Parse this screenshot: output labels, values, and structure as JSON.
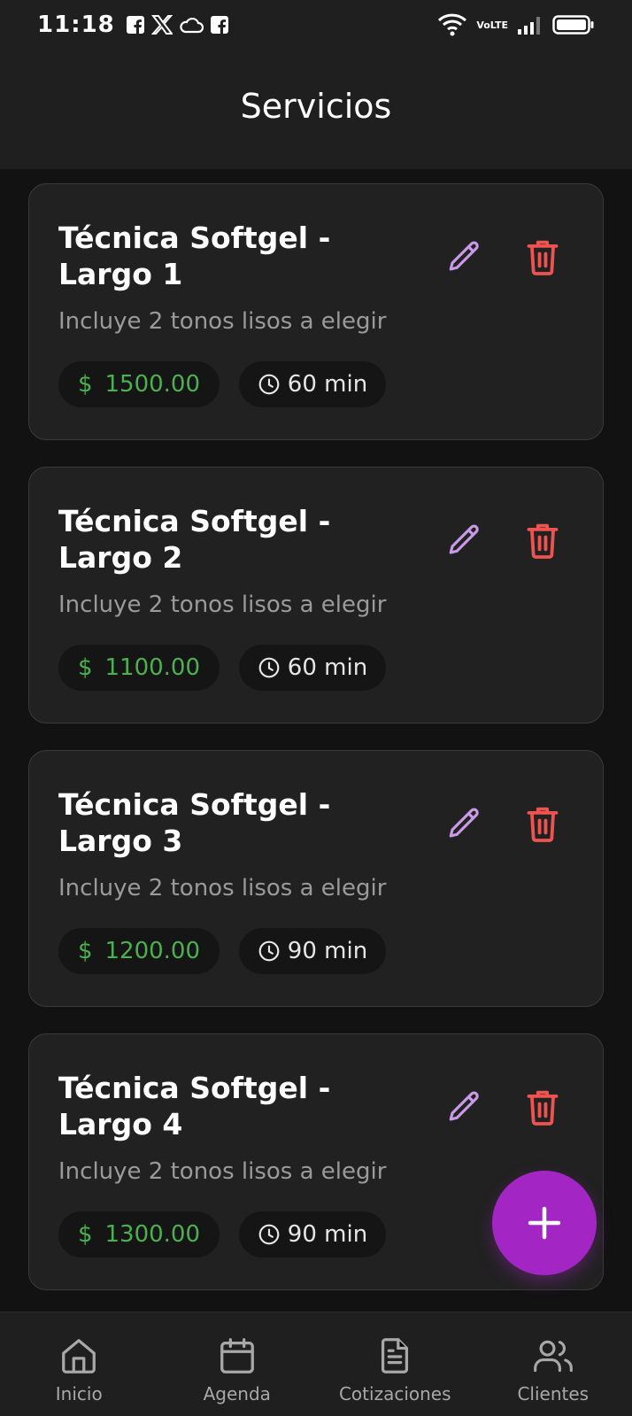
{
  "status_bar": {
    "time": "11:18",
    "left_icons": [
      "facebook-icon",
      "x-icon",
      "cloud-icon",
      "facebook-icon"
    ],
    "volte_top": "Vo",
    "volte_bottom": "LTE",
    "right_icons": [
      "wifi-icon",
      "volte-icon",
      "signal-icon",
      "battery-icon"
    ]
  },
  "app_bar": {
    "title": "Servicios"
  },
  "services": [
    {
      "title": "Técnica Softgel - Largo 1",
      "description": "Incluye 2 tonos lisos a elegir",
      "currency": "$",
      "price": "1500.00",
      "duration": "60 min"
    },
    {
      "title": "Técnica Softgel - Largo 2",
      "description": "Incluye 2 tonos lisos a elegir",
      "currency": "$",
      "price": "1100.00",
      "duration": "60 min"
    },
    {
      "title": "Técnica Softgel - Largo 3",
      "description": "Incluye 2 tonos lisos a elegir",
      "currency": "$",
      "price": "1200.00",
      "duration": "90 min"
    },
    {
      "title": "Técnica Softgel - Largo 4",
      "description": "Incluye 2 tonos lisos a elegir",
      "currency": "$",
      "price": "1300.00",
      "duration": "90 min"
    }
  ],
  "fab": {
    "icon": "plus-icon"
  },
  "bottom_nav": {
    "items": [
      {
        "label": "Inicio",
        "icon": "home-icon"
      },
      {
        "label": "Agenda",
        "icon": "calendar-icon"
      },
      {
        "label": "Cotizaciones",
        "icon": "document-icon"
      },
      {
        "label": "Clientes",
        "icon": "users-icon"
      }
    ]
  },
  "colors": {
    "background": "#121212",
    "surface": "#212121",
    "app_bar": "#1f1f1f",
    "price_green": "#4cb050",
    "edit_purple": "#c99ae6",
    "delete_red": "#ef5350",
    "fab_purple": "#a326c4"
  }
}
